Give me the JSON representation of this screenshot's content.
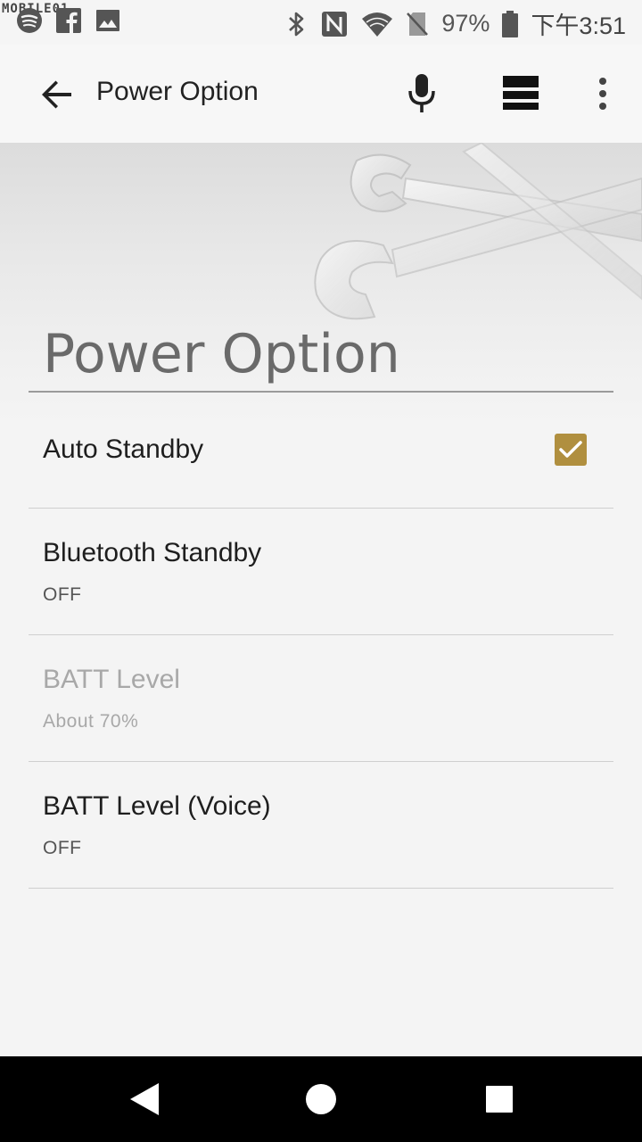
{
  "watermark": "MOBILE01",
  "status_bar": {
    "battery_percent": "97%",
    "time": "下午3:51",
    "left_icons": [
      "spotify-icon",
      "facebook-icon",
      "image-icon"
    ],
    "right_icons": [
      "bluetooth-icon",
      "nfc-icon",
      "wifi-icon",
      "no-sim-icon",
      "battery-icon"
    ]
  },
  "app_bar": {
    "title": "Power Option"
  },
  "section": {
    "title": "Power Option"
  },
  "settings": [
    {
      "label": "Auto Standby",
      "sub": "",
      "checked": true,
      "enabled": true
    },
    {
      "label": "Bluetooth Standby",
      "sub": "OFF",
      "enabled": true
    },
    {
      "label": "BATT Level",
      "sub": "About 70%",
      "enabled": false
    },
    {
      "label": "BATT Level (Voice)",
      "sub": "OFF",
      "enabled": true
    }
  ],
  "colors": {
    "accent_checkbox": "#b08f3f",
    "nav_bar": "#000000"
  }
}
